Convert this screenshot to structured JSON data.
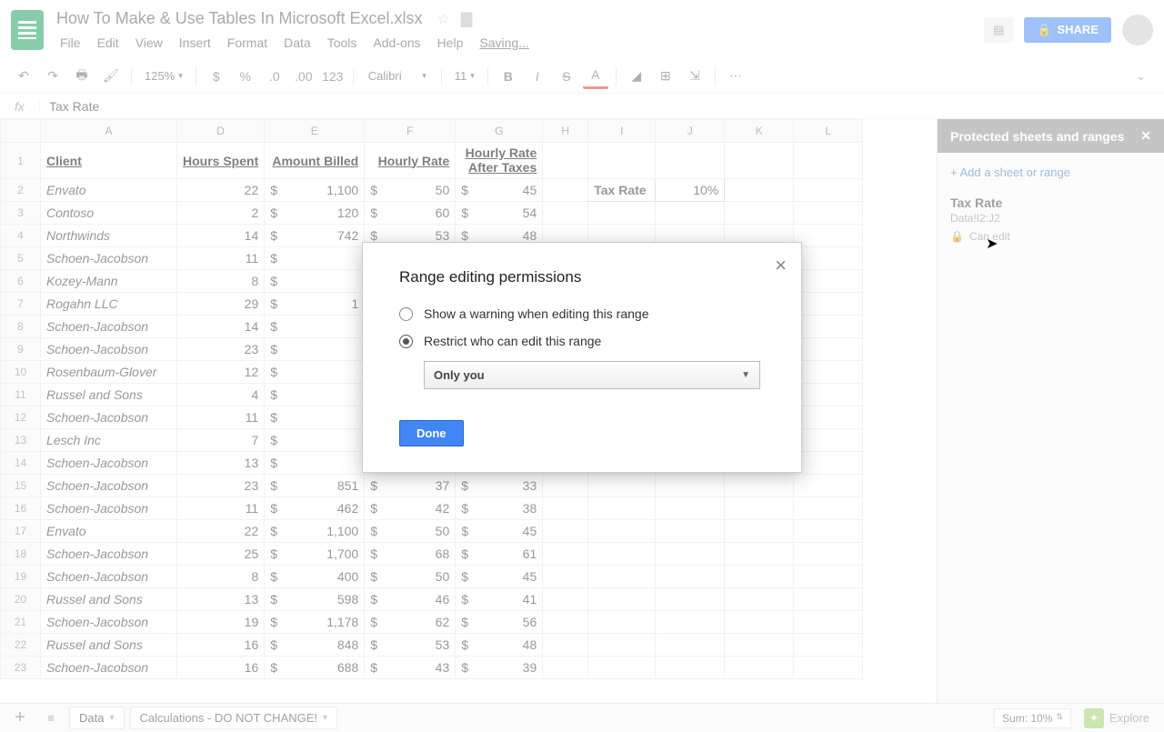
{
  "doc": {
    "title": "How To Make & Use Tables In Microsoft Excel.xlsx",
    "saving": "Saving..."
  },
  "menu": {
    "file": "File",
    "edit": "Edit",
    "view": "View",
    "insert": "Insert",
    "format": "Format",
    "data": "Data",
    "tools": "Tools",
    "addons": "Add-ons",
    "help": "Help"
  },
  "toolbar": {
    "zoom": "125%",
    "font": "Calibri",
    "size": "11",
    "num": "123"
  },
  "share": "SHARE",
  "formula": {
    "value": "Tax Rate"
  },
  "columns": [
    "A",
    "D",
    "E",
    "F",
    "G",
    "H",
    "I",
    "J",
    "K",
    "L"
  ],
  "headers": {
    "client": "Client",
    "hours": "Hours Spent",
    "billed": "Amount Billed",
    "rate": "Hourly Rate",
    "afterTax1": "Hourly Rate",
    "afterTax2": "After Taxes",
    "taxRateLabel": "Tax Rate",
    "taxRateValue": "10%"
  },
  "rows": [
    {
      "n": 2,
      "client": "Envato",
      "hours": "22",
      "billed": "1,100",
      "rate": "50",
      "after": "45"
    },
    {
      "n": 3,
      "client": "Contoso",
      "hours": "2",
      "billed": "120",
      "rate": "60",
      "after": "54"
    },
    {
      "n": 4,
      "client": "Northwinds",
      "hours": "14",
      "billed": "742",
      "rate": "53",
      "after": "48"
    },
    {
      "n": 5,
      "client": "Schoen-Jacobson",
      "hours": "11",
      "billed": "",
      "rate": "",
      "after": ""
    },
    {
      "n": 6,
      "client": "Kozey-Mann",
      "hours": "8",
      "billed": "",
      "rate": "",
      "after": ""
    },
    {
      "n": 7,
      "client": "Rogahn LLC",
      "hours": "29",
      "billed": "1",
      "rate": "",
      "after": ""
    },
    {
      "n": 8,
      "client": "Schoen-Jacobson",
      "hours": "14",
      "billed": "",
      "rate": "",
      "after": ""
    },
    {
      "n": 9,
      "client": "Schoen-Jacobson",
      "hours": "23",
      "billed": "",
      "rate": "",
      "after": ""
    },
    {
      "n": 10,
      "client": "Rosenbaum-Glover",
      "hours": "12",
      "billed": "",
      "rate": "",
      "after": ""
    },
    {
      "n": 11,
      "client": "Russel and Sons",
      "hours": "4",
      "billed": "",
      "rate": "",
      "after": ""
    },
    {
      "n": 12,
      "client": "Schoen-Jacobson",
      "hours": "11",
      "billed": "",
      "rate": "",
      "after": ""
    },
    {
      "n": 13,
      "client": "Lesch Inc",
      "hours": "7",
      "billed": "",
      "rate": "",
      "after": ""
    },
    {
      "n": 14,
      "client": "Schoen-Jacobson",
      "hours": "13",
      "billed": "",
      "rate": "",
      "after": ""
    },
    {
      "n": 15,
      "client": "Schoen-Jacobson",
      "hours": "23",
      "billed": "851",
      "rate": "37",
      "after": "33"
    },
    {
      "n": 16,
      "client": "Schoen-Jacobson",
      "hours": "11",
      "billed": "462",
      "rate": "42",
      "after": "38"
    },
    {
      "n": 17,
      "client": "Envato",
      "hours": "22",
      "billed": "1,100",
      "rate": "50",
      "after": "45"
    },
    {
      "n": 18,
      "client": "Schoen-Jacobson",
      "hours": "25",
      "billed": "1,700",
      "rate": "68",
      "after": "61"
    },
    {
      "n": 19,
      "client": "Schoen-Jacobson",
      "hours": "8",
      "billed": "400",
      "rate": "50",
      "after": "45"
    },
    {
      "n": 20,
      "client": "Russel and Sons",
      "hours": "13",
      "billed": "598",
      "rate": "46",
      "after": "41"
    },
    {
      "n": 21,
      "client": "Schoen-Jacobson",
      "hours": "19",
      "billed": "1,178",
      "rate": "62",
      "after": "56"
    },
    {
      "n": 22,
      "client": "Russel and Sons",
      "hours": "16",
      "billed": "848",
      "rate": "53",
      "after": "48"
    },
    {
      "n": 23,
      "client": "Schoen-Jacobson",
      "hours": "16",
      "billed": "688",
      "rate": "43",
      "after": "39"
    }
  ],
  "panel": {
    "title": "Protected sheets and ranges",
    "add": "+ Add a sheet or range",
    "range_name": "Tax Rate",
    "range_ref": "Data!I2:J2",
    "can_edit": "Can edit"
  },
  "modal": {
    "title": "Range editing permissions",
    "opt1": "Show a warning when editing this range",
    "opt2": "Restrict who can edit this range",
    "select": "Only you",
    "done": "Done"
  },
  "tabs": {
    "data": "Data",
    "calc": "Calculations - DO NOT CHANGE!"
  },
  "footer": {
    "sum": "Sum: 10%",
    "explore": "Explore"
  }
}
